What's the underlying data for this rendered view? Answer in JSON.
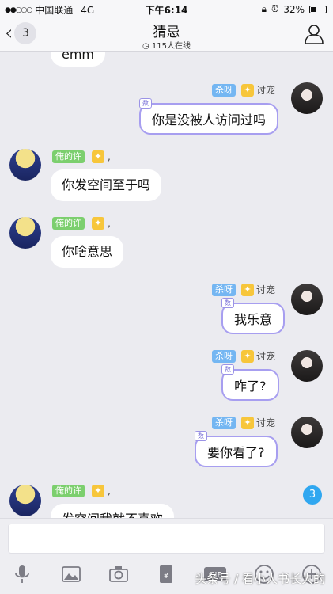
{
  "status_bar": {
    "signal": "●●○○○",
    "carrier": "中国联通",
    "network": "4G",
    "time": "下午6:14",
    "battery": "32%"
  },
  "header": {
    "back_count": "3",
    "title": "猜忌",
    "online_count": "115人在线"
  },
  "messages": [
    {
      "side": "left",
      "text": "emm",
      "partial": true
    },
    {
      "side": "right",
      "tag": "杀呀",
      "nick": "讨宠",
      "text": "你是没被人访问过吗",
      "num_badge": "数"
    },
    {
      "side": "left",
      "tag": "俺的许",
      "suffix": ",",
      "text": "你发空间至于吗"
    },
    {
      "side": "left",
      "tag": "俺的许",
      "suffix": ",",
      "text": "你啥意思"
    },
    {
      "side": "right",
      "tag": "杀呀",
      "nick": "讨宠",
      "text": "我乐意",
      "num_badge": "数"
    },
    {
      "side": "right",
      "tag": "杀呀",
      "nick": "讨宠",
      "text": "咋了?",
      "num_badge": "数"
    },
    {
      "side": "right",
      "tag": "杀呀",
      "nick": "讨宠",
      "text": "要你看了?",
      "num_badge": "数"
    },
    {
      "side": "left",
      "tag": "俺的许",
      "suffix": ",",
      "text": "发空间我就不喜欢",
      "partial": true
    }
  ],
  "new_message_badge": "3",
  "input": {
    "placeholder": ""
  },
  "toolbar": {
    "icons": [
      "mic-icon",
      "image-icon",
      "camera-icon",
      "red-packet-icon",
      "gif-icon",
      "emoji-icon",
      "plus-icon"
    ],
    "gif_label": "GIF"
  },
  "watermark": "头条号 / 看小人书长大的",
  "colors": {
    "accent_purple": "#a79ef0",
    "tag_green": "#7ccf6e",
    "tag_blue": "#74b6f2",
    "badge_blue": "#30a7f0"
  }
}
